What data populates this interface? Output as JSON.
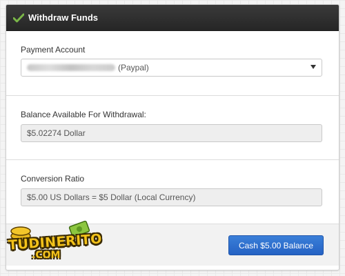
{
  "panel": {
    "title": "Withdraw Funds",
    "header_icon": "check-icon",
    "header_bg": "#2e2e2e",
    "check_color": "#7ab648"
  },
  "payment": {
    "label": "Payment Account",
    "selected_suffix": "(Paypal)"
  },
  "balance": {
    "label": "Balance Available For Withdrawal:",
    "value": "$5.02274 Dollar"
  },
  "conversion": {
    "label": "Conversion Ratio",
    "value": "$5.00 US Dollars = $5 Dollar (Local Currency)"
  },
  "footer": {
    "button_label": "Cash $5.00 Balance",
    "button_color": "#2d6fd0"
  },
  "watermark": {
    "word": "TUDINERITO",
    "sub": ".COM"
  }
}
